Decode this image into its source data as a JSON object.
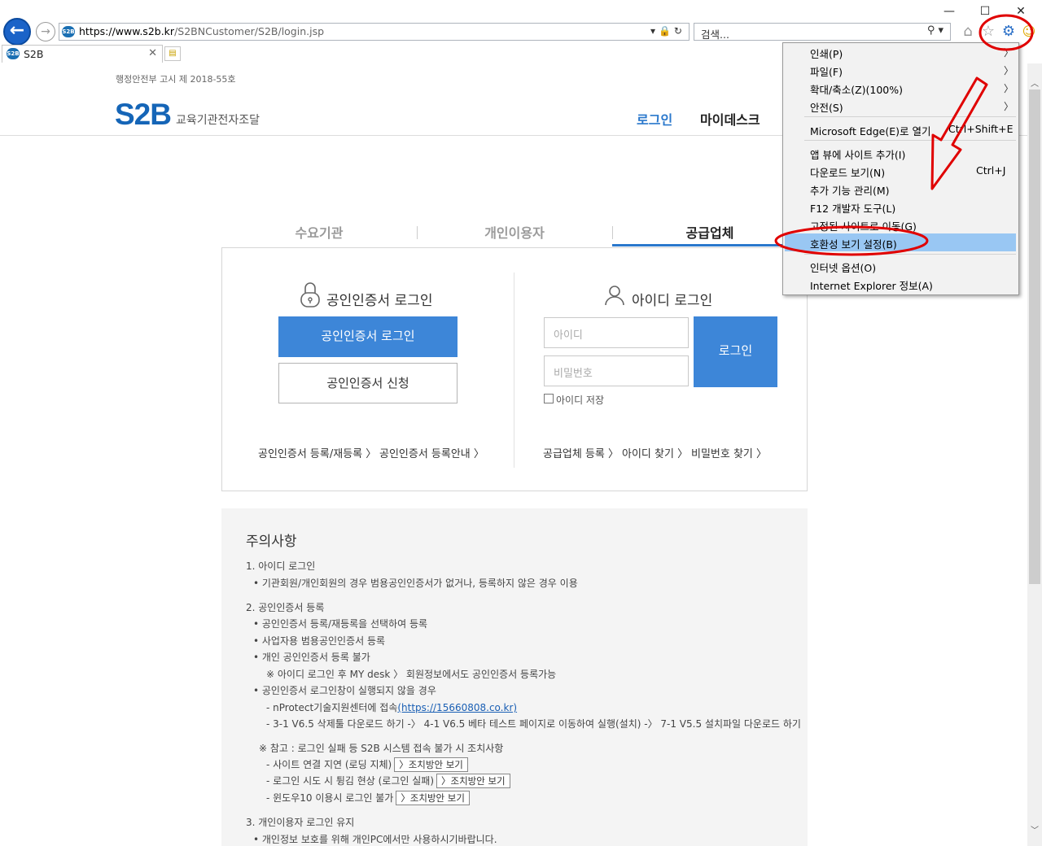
{
  "browser": {
    "address_host": "https://www.s2b.kr",
    "address_path": "/S2BNCustomer/S2B/login.jsp",
    "addr_tools": "▾🔒↻",
    "search_placeholder": "검색...",
    "search_tools": "⚲ ▾",
    "tab_title": "S2B",
    "site_favicon_text": "S2B",
    "icons": [
      "back-icon",
      "forward-icon",
      "home-icon",
      "favorites-star-icon",
      "gear-icon",
      "smiley-icon",
      "minimize-icon",
      "maximize-icon",
      "close-icon"
    ],
    "win_controls": {
      "minimize": "—",
      "maximize": "☐",
      "close": "✕"
    }
  },
  "header": {
    "gov_notice": "행정안전부 고시 제 2018-55호",
    "logo_mark": "S2B",
    "logo_text": "교육기관전자조달",
    "nav": {
      "login": "로그인",
      "mydesk": "마이데스크"
    }
  },
  "tabs": [
    {
      "label": "수요기관",
      "active": false
    },
    {
      "label": "개인이용자",
      "active": false
    },
    {
      "label": "공급업체",
      "active": true
    }
  ],
  "cert_login": {
    "title": "공인인증서 로그인",
    "login_button": "공인인증서 로그인",
    "apply_button": "공인인증서 신청",
    "links": [
      "공인인증서 등록/재등록 〉",
      "공인인증서 등록안내 〉"
    ]
  },
  "id_login": {
    "title": "아이디 로그인",
    "id_placeholder": "아이디",
    "pw_placeholder": "비밀번호",
    "login_button": "로그인",
    "save_id_label": "아이디 저장",
    "links": [
      "공급업체 등록 〉",
      "아이디 찾기 〉",
      "비밀번호 찾기 〉"
    ]
  },
  "notice": {
    "title": "주의사항",
    "lines": [
      "1. 아이디 로그인",
      "• 기관회원/개인회원의 경우 범용공인인증서가 없거나, 등록하지 않은 경우 이용",
      "2. 공인인증서 등록",
      "• 공인인증서 등록/재등록을 선택하여 등록",
      "• 사업자용 범용공인인증서 등록",
      "• 개인 공인인증서 등록 불가",
      "※ 아이디 로그인 후 MY desk 〉 회원정보에서도 공인인증서 등록가능",
      "• 공인인증서 로그인창이 실행되지 않을 경우",
      "- nProtect기술지원센터에 접속",
      "- 3-1 V6.5 삭제툴 다운로드 하기 -〉 4-1 V6.5 베타 테스트 페이지로 이동하여 실행(설치) -〉 7-1 V5.5 설치파일 다운로드 하기",
      "※ 참고 : 로그인 실패 등 S2B 시스템 접속 불가 시 조치사항",
      "- 사이트 연결 지연 (로딩 지체)",
      "- 로그인 시도 시 튕김 현상 (로그인 실패)",
      "- 윈도우10 이용시 로그인 불가",
      "3. 개인이용자 로그인 유지",
      "• 개인정보 보호를 위해 개인PC에서만 사용하시기바랍니다."
    ],
    "support_link": "(https://15660808.co.kr)",
    "action_button": "〉조치방안 보기"
  },
  "tools_menu": {
    "items": [
      {
        "label": "인쇄(P)",
        "submenu": true
      },
      {
        "label": "파일(F)",
        "submenu": true
      },
      {
        "label": "확대/축소(Z)(100%)",
        "submenu": true
      },
      {
        "label": "안전(S)",
        "submenu": true
      },
      {
        "label": "Microsoft Edge(E)로 열기",
        "accel": "Ctrl+Shift+E"
      },
      {
        "label": "앱 뷰에 사이트 추가(I)"
      },
      {
        "label": "다운로드 보기(N)",
        "accel": "Ctrl+J"
      },
      {
        "label": "추가 기능 관리(M)"
      },
      {
        "label": "F12 개발자 도구(L)"
      },
      {
        "label": "고정된 사이트로 이동(G)"
      },
      {
        "label": "호환성 보기 설정(B)",
        "highlighted": true
      },
      {
        "label": "인터넷 옵션(O)"
      },
      {
        "label": "Internet Explorer 정보(A)"
      }
    ],
    "submenu_arrow": "〉"
  },
  "colors": {
    "brand": "#1565b7",
    "accent": "#3d86d8",
    "annotation": "#e00000",
    "menu_highlight": "#99c7f3"
  }
}
